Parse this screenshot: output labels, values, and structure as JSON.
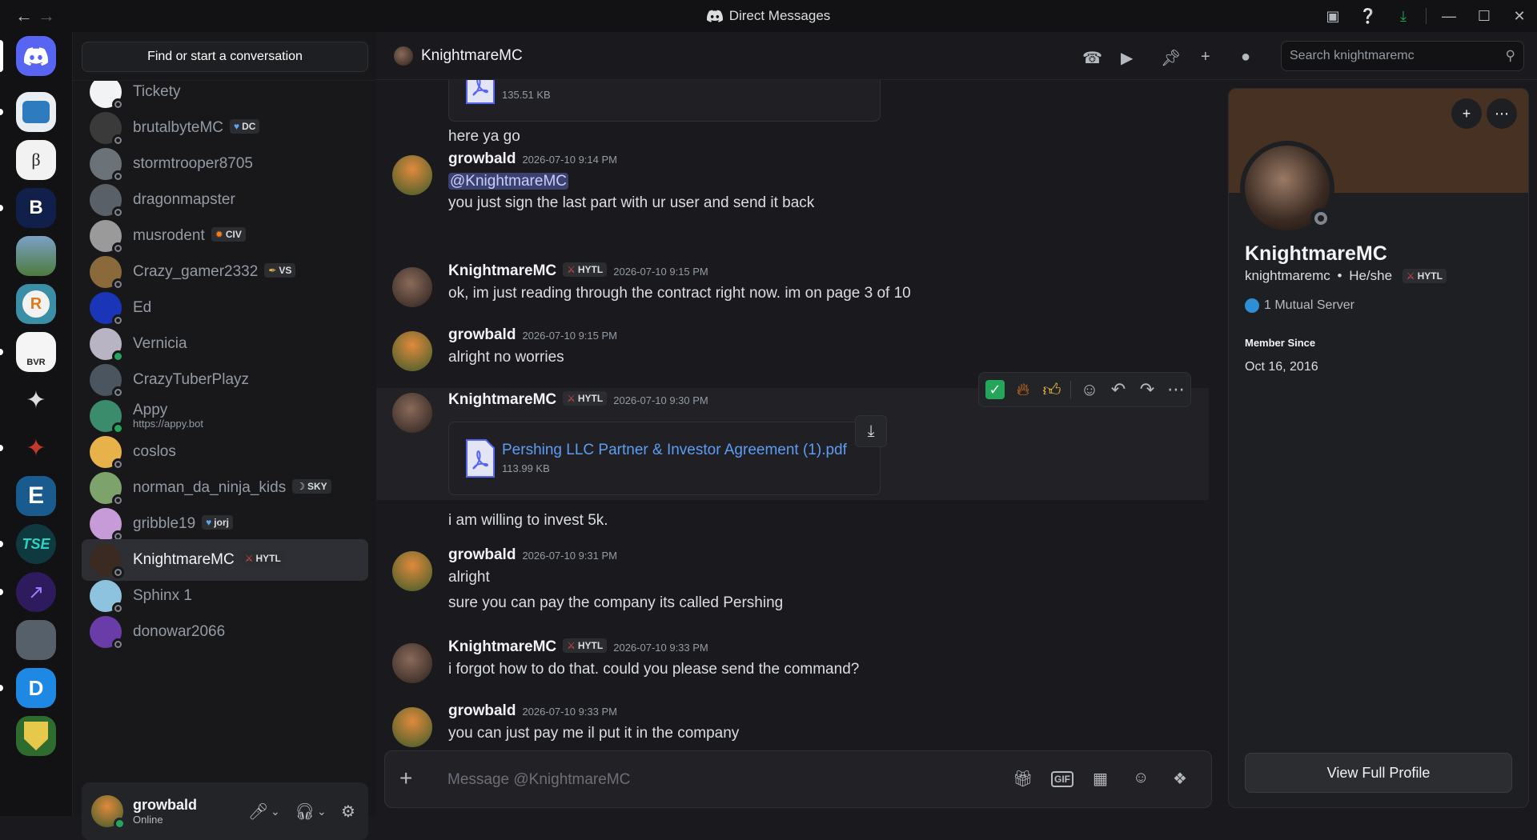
{
  "titlebar": {
    "title": "Direct Messages"
  },
  "dm_list": {
    "search_label": "Find or start a conversation",
    "items": [
      {
        "name": "Tickety",
        "tag": "",
        "sub": "",
        "online": false,
        "color": "#f2f3f5"
      },
      {
        "name": "brutalbyteMC",
        "tag": "DC",
        "tag_icon": "heart-icon",
        "sub": "",
        "online": false,
        "color": "#3a3a3a"
      },
      {
        "name": "stormtrooper8705",
        "tag": "",
        "sub": "",
        "online": false,
        "color": "#6c7378"
      },
      {
        "name": "dragonmapster",
        "tag": "",
        "sub": "",
        "online": false,
        "color": "#5a6068"
      },
      {
        "name": "musrodent",
        "tag": "CIV",
        "tag_icon": "flame-icon",
        "sub": "",
        "online": false,
        "color": "#9a9a9a"
      },
      {
        "name": "Crazy_gamer2332",
        "tag": "VS",
        "tag_icon": "feather-icon",
        "sub": "",
        "online": false,
        "color": "#8a6a3a"
      },
      {
        "name": "Ed",
        "tag": "",
        "sub": "",
        "online": false,
        "color": "#1b35b8"
      },
      {
        "name": "Vernicia",
        "tag": "",
        "sub": "",
        "online": true,
        "color": "#b9b4c4"
      },
      {
        "name": "CrazyTuberPlayz",
        "tag": "",
        "sub": "",
        "online": false,
        "color": "#4b5560"
      },
      {
        "name": "Appy",
        "tag": "",
        "sub": "https://appy.bot",
        "online": true,
        "color": "#3b8c6d"
      },
      {
        "name": "coslos",
        "tag": "",
        "sub": "",
        "online": false,
        "color": "#e8b24a"
      },
      {
        "name": "norman_da_ninja_kids",
        "tag": "SKY",
        "tag_icon": "moon-icon",
        "sub": "",
        "online": false,
        "color": "#7ea26b"
      },
      {
        "name": "gribble19",
        "tag": "jorj",
        "tag_icon": "heart-icon",
        "sub": "",
        "online": false,
        "color": "#c79ad8"
      },
      {
        "name": "KnightmareMC",
        "tag": "HYTL",
        "tag_icon": "sword-icon",
        "sub": "",
        "online": false,
        "color": "#3a2a22",
        "active": true
      },
      {
        "name": "Sphinx 1",
        "tag": "",
        "sub": "",
        "online": false,
        "color": "#8ec3e0"
      },
      {
        "name": "donowar2066",
        "tag": "",
        "sub": "",
        "online": false,
        "color": "#6a3ca8"
      }
    ]
  },
  "user_panel": {
    "name": "growbald",
    "status": "Online"
  },
  "chat": {
    "recipient": "KnightmareMC",
    "search_placeholder": "Search knightmaremc",
    "composer_placeholder": "Message @KnightmareMC",
    "top_attachment_size": "135.51 KB",
    "messages": [
      {
        "line": "here ya go"
      },
      {
        "author": "growbald",
        "time": "2026-07-10 9:14 PM",
        "mention": "@KnightmareMC",
        "line": "you just sign the last part with ur user and send it back"
      },
      {
        "author": "KnightmareMC",
        "tag": "HYTL",
        "time": "2026-07-10 9:15 PM",
        "line": "ok, im just reading through the contract right now. im on page 3 of 10"
      },
      {
        "author": "growbald",
        "time": "2026-07-10 9:15 PM",
        "line": "alright no worries"
      },
      {
        "author": "KnightmareMC",
        "tag": "HYTL",
        "time": "2026-07-10 9:30 PM",
        "file": "Pershing LLC Partner & Investor Agreement (1).pdf",
        "size": "113.99 KB",
        "line": "i am willing to invest 5k."
      },
      {
        "author": "growbald",
        "time": "2026-07-10 9:31 PM",
        "line": "alright",
        "line2": "sure you can pay the company its called Pershing"
      },
      {
        "author": "KnightmareMC",
        "tag": "HYTL",
        "time": "2026-07-10 9:33 PM",
        "line": "i forgot how to do that. could you please send the command?"
      },
      {
        "author": "growbald",
        "time": "2026-07-10 9:33 PM",
        "line": "you can just pay me il put it in the company"
      }
    ],
    "reactions": [
      "white-check-mark",
      "fire",
      "thumbs-up"
    ]
  },
  "profile": {
    "display_name": "KnightmareMC",
    "username": "knightmaremc",
    "pronouns": "He/she",
    "tag": "HYTL",
    "mutual": "1 Mutual Server",
    "member_since_label": "Member Since",
    "member_since": "Oct 16, 2016",
    "view_button": "View Full Profile"
  },
  "colors": {
    "accent": "#5865f2",
    "online": "#23a55a",
    "link": "#5d9cf5",
    "banner": "#473123"
  }
}
